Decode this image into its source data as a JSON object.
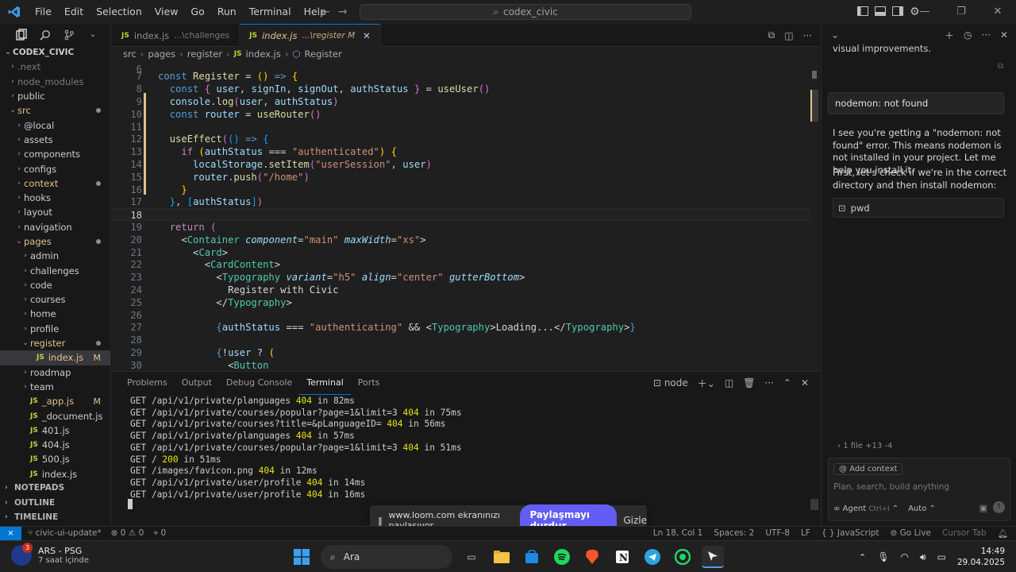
{
  "titlebar": {
    "menu": [
      "File",
      "Edit",
      "Selection",
      "View",
      "Go",
      "Run",
      "Terminal",
      "Help"
    ],
    "search": "codex_civic"
  },
  "explorer": {
    "root": "CODEX_CIVIC",
    "items": [
      {
        "label": ".next",
        "indent": 1,
        "chev": "›",
        "cls": "dim"
      },
      {
        "label": "node_modules",
        "indent": 1,
        "chev": "›",
        "cls": "dim"
      },
      {
        "label": "public",
        "indent": 1,
        "chev": "›",
        "cls": ""
      },
      {
        "label": "src",
        "indent": 1,
        "chev": "⌄",
        "cls": "git",
        "dot": true
      },
      {
        "label": "@local",
        "indent": 2,
        "chev": "›",
        "cls": ""
      },
      {
        "label": "assets",
        "indent": 2,
        "chev": "›",
        "cls": ""
      },
      {
        "label": "components",
        "indent": 2,
        "chev": "›",
        "cls": ""
      },
      {
        "label": "configs",
        "indent": 2,
        "chev": "›",
        "cls": ""
      },
      {
        "label": "context",
        "indent": 2,
        "chev": "›",
        "cls": "git",
        "dot": true
      },
      {
        "label": "hooks",
        "indent": 2,
        "chev": "›",
        "cls": ""
      },
      {
        "label": "layout",
        "indent": 2,
        "chev": "›",
        "cls": ""
      },
      {
        "label": "navigation",
        "indent": 2,
        "chev": "›",
        "cls": ""
      },
      {
        "label": "pages",
        "indent": 2,
        "chev": "⌄",
        "cls": "git",
        "dot": true
      },
      {
        "label": "admin",
        "indent": 3,
        "chev": "›",
        "cls": ""
      },
      {
        "label": "challenges",
        "indent": 3,
        "chev": "›",
        "cls": ""
      },
      {
        "label": "code",
        "indent": 3,
        "chev": "›",
        "cls": ""
      },
      {
        "label": "courses",
        "indent": 3,
        "chev": "›",
        "cls": ""
      },
      {
        "label": "home",
        "indent": 3,
        "chev": "›",
        "cls": ""
      },
      {
        "label": "profile",
        "indent": 3,
        "chev": "›",
        "cls": ""
      },
      {
        "label": "register",
        "indent": 3,
        "chev": "⌄",
        "cls": "git",
        "dot": true
      },
      {
        "label": "index.js",
        "indent": 4,
        "chev": "",
        "cls": "git sel",
        "js": true,
        "mark": "M"
      },
      {
        "label": "roadmap",
        "indent": 3,
        "chev": "›",
        "cls": ""
      },
      {
        "label": "team",
        "indent": 3,
        "chev": "›",
        "cls": ""
      },
      {
        "label": "_app.js",
        "indent": 3,
        "chev": "",
        "cls": "git",
        "js": true,
        "mark": "M"
      },
      {
        "label": "_document.js",
        "indent": 3,
        "chev": "",
        "cls": "",
        "js": true
      },
      {
        "label": "401.js",
        "indent": 3,
        "chev": "",
        "cls": "",
        "js": true
      },
      {
        "label": "404.js",
        "indent": 3,
        "chev": "",
        "cls": "",
        "js": true
      },
      {
        "label": "500.js",
        "indent": 3,
        "chev": "",
        "cls": "",
        "js": true
      },
      {
        "label": "index.js",
        "indent": 3,
        "chev": "",
        "cls": "",
        "js": true
      }
    ],
    "sections": [
      "NOTEPADS",
      "OUTLINE",
      "TIMELINE"
    ]
  },
  "tabs": [
    {
      "label": "index.js",
      "desc": "...\\challenges",
      "active": false
    },
    {
      "label": "index.js",
      "desc": "...\\register M",
      "active": true
    }
  ],
  "breadcrumb": [
    "src",
    "pages",
    "register",
    "index.js",
    "Register"
  ],
  "editor": {
    "current_line": "18"
  },
  "panel": {
    "tabs": [
      "Problems",
      "Output",
      "Debug Console",
      "Terminal",
      "Ports"
    ],
    "active_tab": "Terminal",
    "shell": "node",
    "terminal_lines": [
      {
        "text": "GET /api/v1/private/planguages ",
        "status": "404",
        "tail": " in 82ms"
      },
      {
        "text": "GET /api/v1/private/courses/popular?page=1&limit=3 ",
        "status": "404",
        "tail": " in 75ms"
      },
      {
        "text": "GET /api/v1/private/courses?title=&pLanguageID= ",
        "status": "404",
        "tail": " in 56ms"
      },
      {
        "text": "GET /api/v1/private/planguages ",
        "status": "404",
        "tail": " in 57ms"
      },
      {
        "text": "GET /api/v1/private/courses/popular?page=1&limit=3 ",
        "status": "404",
        "tail": " in 51ms"
      },
      {
        "text": "GET / ",
        "status": "200",
        "tail": " in 51ms"
      },
      {
        "text": "GET /images/favicon.png ",
        "status": "404",
        "tail": " in 12ms"
      },
      {
        "text": "GET /api/v1/private/user/profile ",
        "status": "404",
        "tail": " in 14ms"
      },
      {
        "text": "GET /api/v1/private/user/profile ",
        "status": "404",
        "tail": " in 16ms"
      }
    ]
  },
  "loom": {
    "message": "www.loom.com ekranınızı paylaşıyor.",
    "stop_label": "Paylaşmayı durdur",
    "hide_label": "Gizle"
  },
  "chat": {
    "prev_tail": "visual improvements.",
    "user_msg": "nodemon: not found",
    "para1": "I see you're getting a \"nodemon: not found\" error. This means nodemon is not installed in your project. Let me help you install it.",
    "para2": "First, let's check if we're in the correct directory and then install nodemon:",
    "cmd": "pwd",
    "files": "1 file +13 -4",
    "add_context": "Add context",
    "placeholder": "Plan, search, build anything",
    "agent": "Agent",
    "agent_shortcut": "Ctrl+I",
    "auto": "Auto"
  },
  "statusbar": {
    "branch": "civic-ui-update*",
    "errors": "0",
    "warnings": "0",
    "ports": "0",
    "position": "Ln 18, Col 1",
    "spaces": "Spaces: 2",
    "encoding": "UTF-8",
    "eol": "LF",
    "language": "JavaScript",
    "golive": "Go Live",
    "cursortab": "Cursor Tab"
  },
  "taskbar": {
    "weather_title": "ARS - PSG",
    "weather_sub": "7 saat içinde",
    "badge": "3",
    "search": "Ara",
    "time": "14:49",
    "date": "29.04.2025"
  },
  "colors": {
    "accent": "#0078d4",
    "git_modified": "#e2c08d",
    "loom": "#625df5"
  }
}
